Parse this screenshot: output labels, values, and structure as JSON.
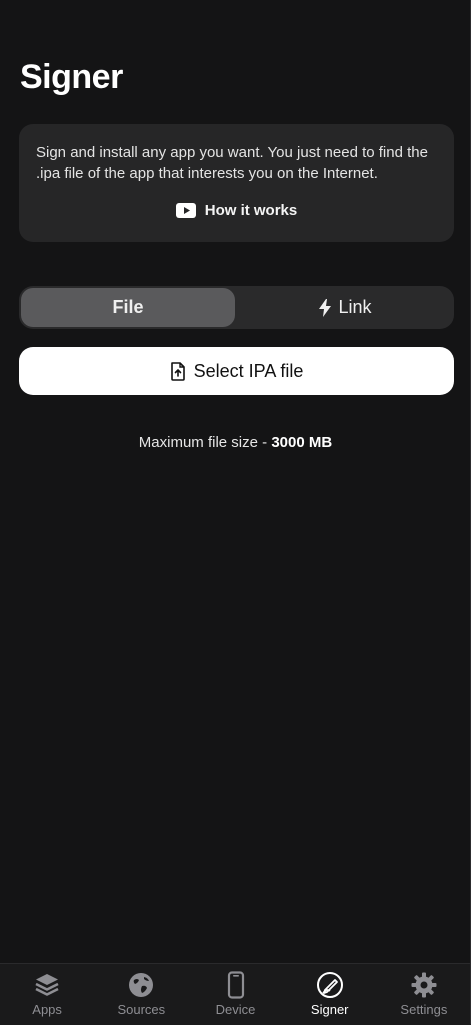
{
  "header": {
    "title": "Signer"
  },
  "info": {
    "text": "Sign and install any app you want. You just need to find the .ipa file of the app that interests you on the Internet.",
    "link_label": "How it works",
    "link_icon": "youtube-play-icon"
  },
  "segment": {
    "file_label": "File",
    "link_label": "Link",
    "selected": "File"
  },
  "select_button": {
    "label": "Select IPA file",
    "icon": "file-upload-icon"
  },
  "max_size": {
    "prefix": "Maximum file size - ",
    "value": "3000 MB"
  },
  "tabbar": {
    "items": [
      {
        "label": "Apps",
        "icon": "layers-icon"
      },
      {
        "label": "Sources",
        "icon": "globe-icon"
      },
      {
        "label": "Device",
        "icon": "phone-icon"
      },
      {
        "label": "Signer",
        "icon": "signature-icon",
        "active": true
      },
      {
        "label": "Settings",
        "icon": "gear-icon"
      }
    ]
  },
  "colors": {
    "background": "#141415",
    "card": "#262627",
    "segment_selected": "#5a5a5c",
    "button": "#ffffff",
    "tab_inactive": "#8e8e93",
    "tab_active": "#ffffff"
  }
}
